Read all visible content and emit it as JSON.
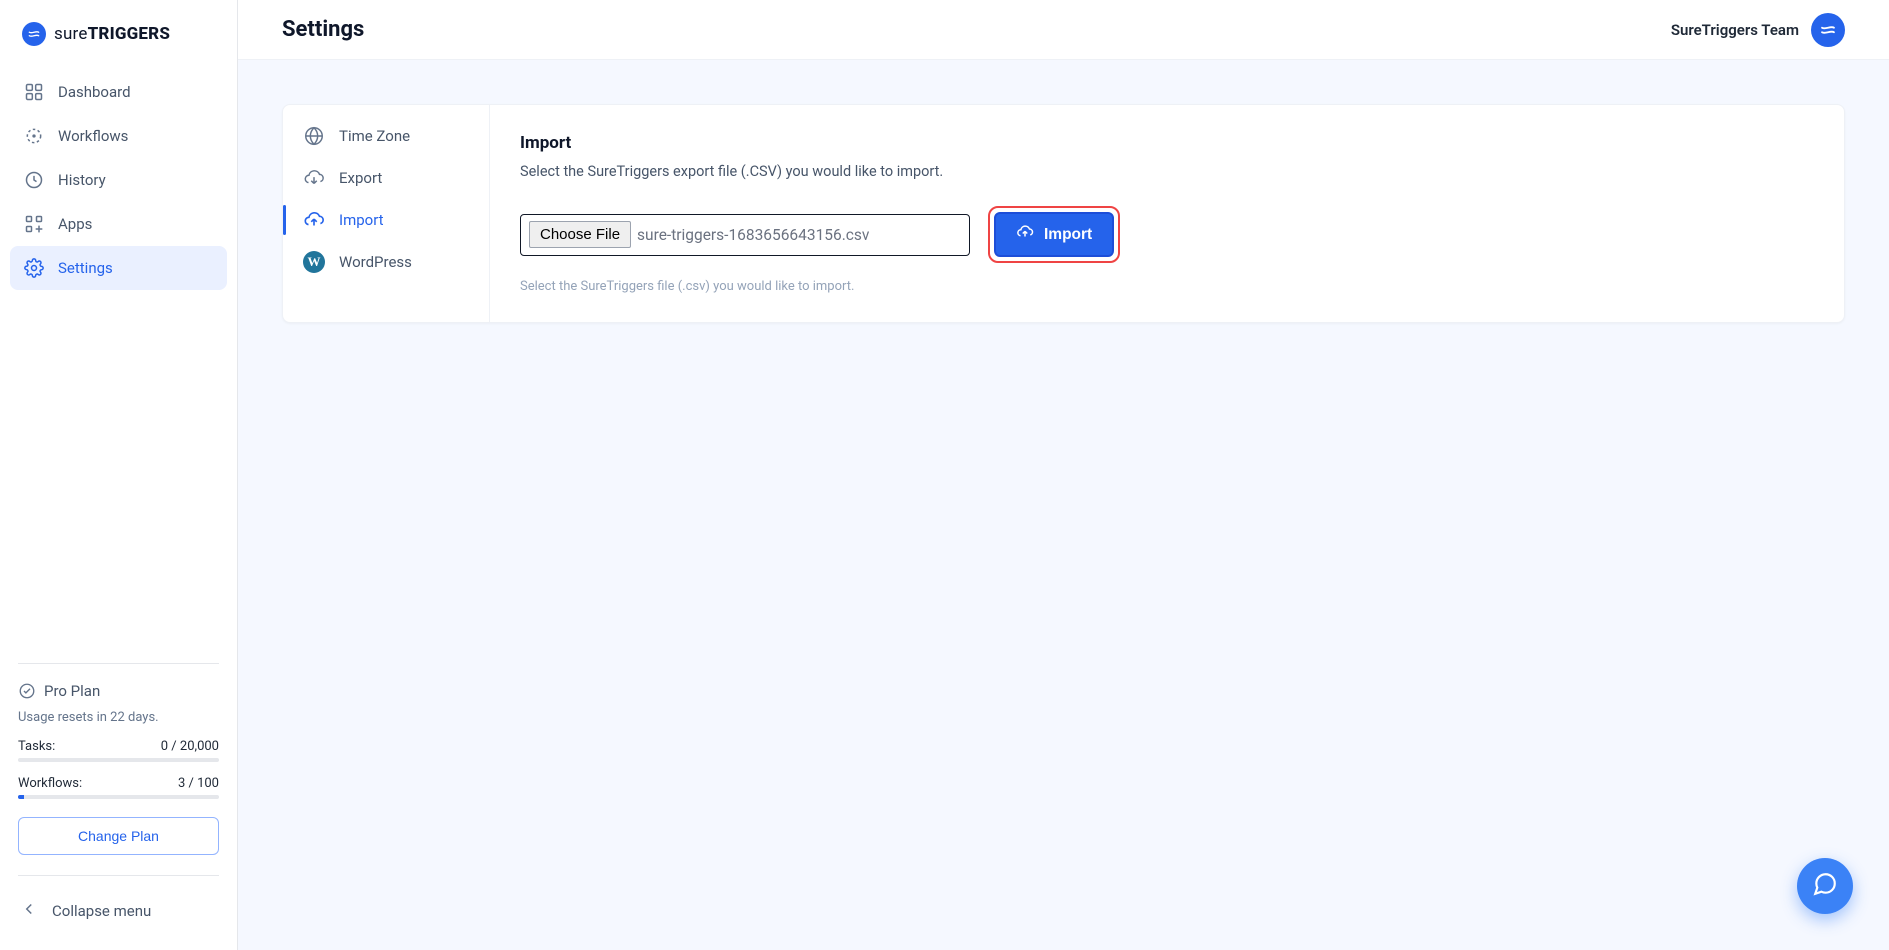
{
  "brand": {
    "thin": "sure",
    "bold": "TRIGGERS"
  },
  "sidebar": {
    "items": [
      {
        "label": "Dashboard"
      },
      {
        "label": "Workflows"
      },
      {
        "label": "History"
      },
      {
        "label": "Apps"
      },
      {
        "label": "Settings"
      }
    ],
    "plan": {
      "name": "Pro Plan",
      "usage_note": "Usage resets in 22 days.",
      "tasks_label": "Tasks:",
      "tasks_value": "0 / 20,000",
      "workflows_label": "Workflows:",
      "workflows_value": "3 / 100",
      "change_plan": "Change Plan"
    },
    "collapse": "Collapse menu"
  },
  "header": {
    "title": "Settings",
    "team": "SureTriggers Team"
  },
  "settings_nav": [
    {
      "label": "Time Zone"
    },
    {
      "label": "Export"
    },
    {
      "label": "Import"
    },
    {
      "label": "WordPress"
    }
  ],
  "import_panel": {
    "title": "Import",
    "description": "Select the SureTriggers export file (.CSV) you would like to import.",
    "choose_label": "Choose File",
    "selected_file": "sure-triggers-1683656643156.csv",
    "button": "Import",
    "hint": "Select the SureTriggers file (.csv) you would like to import."
  }
}
